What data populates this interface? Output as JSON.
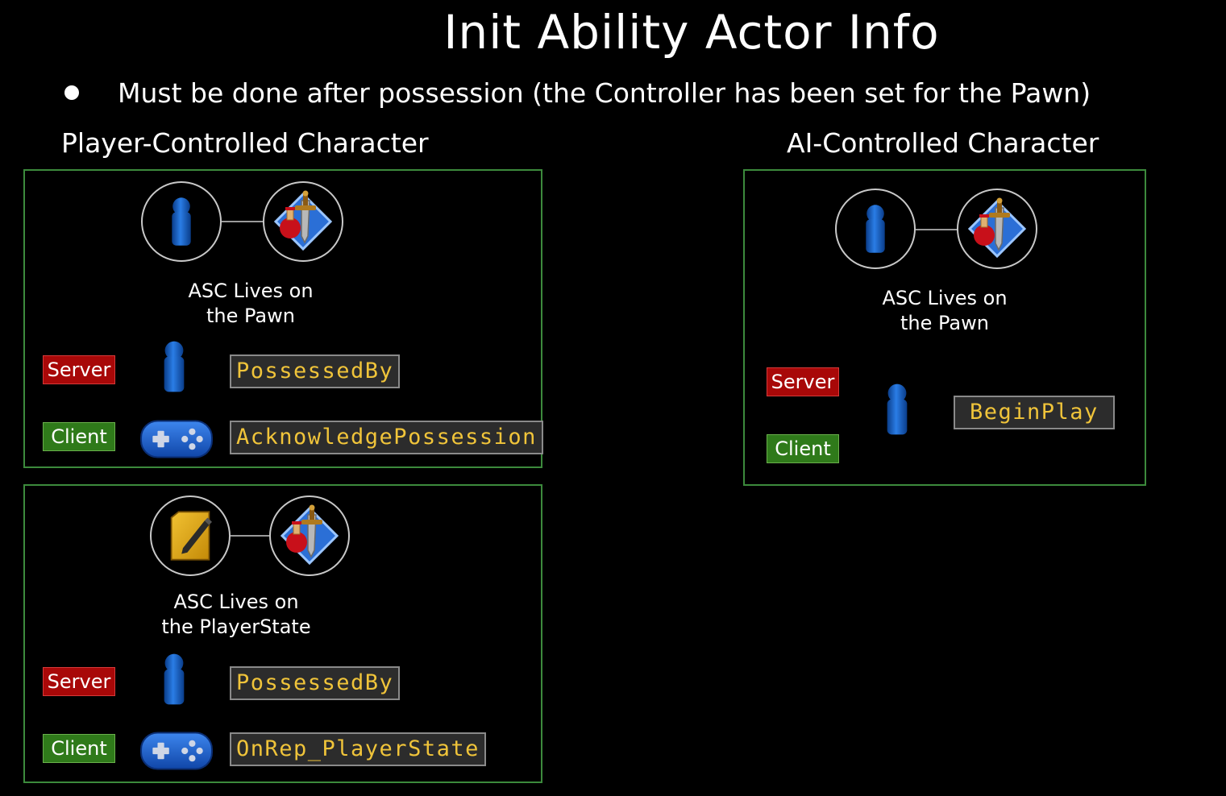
{
  "title": "Init Ability Actor Info",
  "bullet": "Must be done after possession (the Controller has been set for the Pawn)",
  "player_heading": "Player-Controlled Character",
  "ai_heading": "AI-Controlled Character",
  "panels": {
    "player_pawn": {
      "caption_line1": "ASC Lives on",
      "caption_line2": "the Pawn",
      "server_label": "Server",
      "client_label": "Client",
      "server_function": "PossessedBy",
      "client_function": "AcknowledgePossession"
    },
    "player_state": {
      "caption_line1": "ASC Lives on",
      "caption_line2": "the PlayerState",
      "server_label": "Server",
      "client_label": "Client",
      "server_function": "PossessedBy",
      "client_function": "OnRep_PlayerState"
    },
    "ai_pawn": {
      "caption_line1": "ASC Lives on",
      "caption_line2": "the Pawn",
      "server_label": "Server",
      "client_label": "Client",
      "function": "BeginPlay"
    }
  },
  "colors": {
    "border": "#3c8a3c",
    "server": "#a80808",
    "client": "#2f7a1a",
    "function_text": "#f0c43a",
    "pawn": "#1560c8"
  }
}
